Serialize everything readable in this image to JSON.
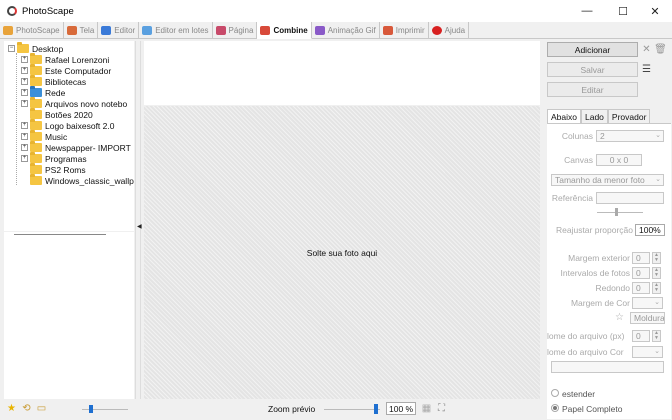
{
  "window": {
    "title": "PhotoScape",
    "minimize": "—",
    "maximize": "☐",
    "close": "✕"
  },
  "tabs": [
    {
      "label": "PhotoScape",
      "color": "#e8a33a"
    },
    {
      "label": "Tela",
      "color": "#d86a3a"
    },
    {
      "label": "Editor",
      "color": "#3a7ad8"
    },
    {
      "label": "Editor em lotes",
      "color": "#5aa0e0"
    },
    {
      "label": "Página",
      "color": "#c84a6a"
    },
    {
      "label": "Combine",
      "color": "#d84a3a"
    },
    {
      "label": "Animação Gif",
      "color": "#8a5ac8"
    },
    {
      "label": "Imprimir",
      "color": "#d8583a"
    },
    {
      "label": "Ajuda",
      "color": "#d82020"
    }
  ],
  "tree": {
    "root": "Desktop",
    "items": [
      {
        "label": "Rafael Lorenzoni",
        "expandable": true,
        "icon": "folder"
      },
      {
        "label": "Este Computador",
        "expandable": true,
        "icon": "folder"
      },
      {
        "label": "Bibliotecas",
        "expandable": true,
        "icon": "folder"
      },
      {
        "label": "Rede",
        "expandable": true,
        "icon": "network"
      },
      {
        "label": "Arquivos novo notebo",
        "expandable": true,
        "icon": "folder"
      },
      {
        "label": "Botões 2020",
        "expandable": false,
        "icon": "folder"
      },
      {
        "label": "Logo baixesoft 2.0",
        "expandable": true,
        "icon": "folder"
      },
      {
        "label": "Music",
        "expandable": true,
        "icon": "folder"
      },
      {
        "label": "Newspapper- IMPORT",
        "expandable": true,
        "icon": "folder"
      },
      {
        "label": "Programas",
        "expandable": true,
        "icon": "folder"
      },
      {
        "label": "PS2 Roms",
        "expandable": false,
        "icon": "folder"
      },
      {
        "label": "Windows_classic_wallp",
        "expandable": false,
        "icon": "folder"
      }
    ]
  },
  "canvas": {
    "drop_text": "Solte sua foto aqui"
  },
  "right": {
    "add": "Adicionar",
    "save": "Salvar",
    "edit": "Editar",
    "tabs": [
      "Abaixo",
      "Lado",
      "Provador"
    ],
    "columns_label": "Colunas",
    "columns_value": "2",
    "canvas_label": "Canvas",
    "canvas_value": "0 x 0",
    "size_mode": "Tamanho da menor foto",
    "reference_label": "Referência",
    "reference_value": "",
    "proportion_label": "Reajustar proporção",
    "proportion_value": "100%",
    "outer_margin_label": "Margem exterior",
    "outer_margin_value": "0",
    "photo_spacing_label": "Intervalos de fotos",
    "photo_spacing_value": "0",
    "rounded_label": "Redondo",
    "rounded_value": "0",
    "margin_color_label": "Margem de Cor",
    "frame_label": "Moldura",
    "filename_px_label": "lome do arquivo (px)",
    "filename_px_value": "0",
    "filename_color_label": "lome do arquivo Cor",
    "extend_label": "estender",
    "full_paper_label": "Papel Completo"
  },
  "status": {
    "zoom_label": "Zoom prévio",
    "zoom_value": "100 %"
  }
}
